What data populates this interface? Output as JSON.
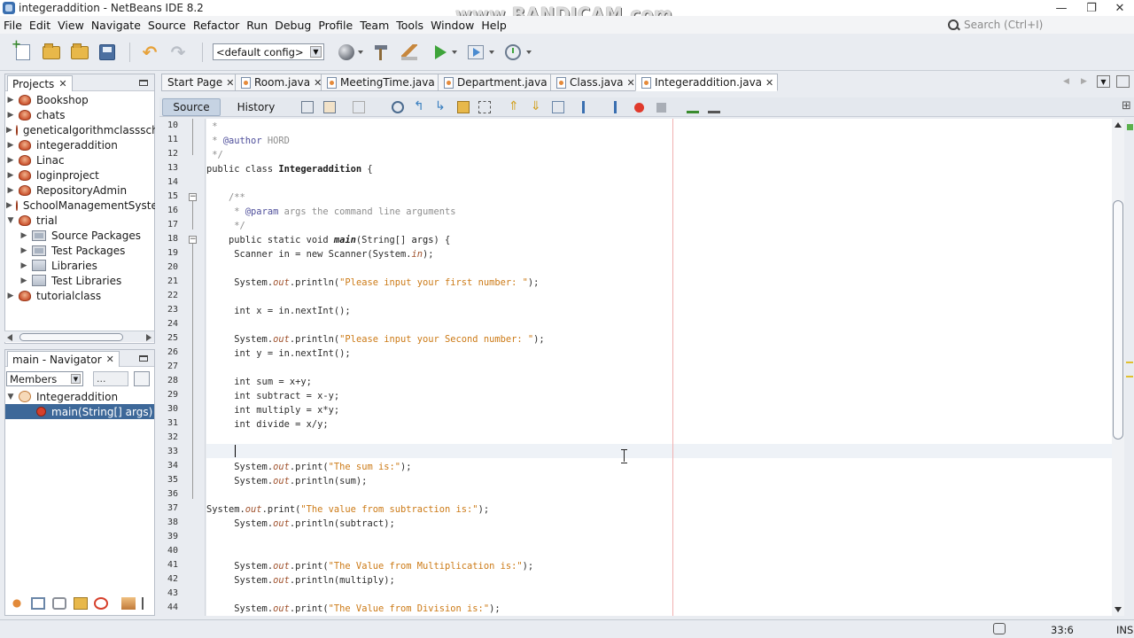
{
  "window": {
    "title": "integeraddition - NetBeans IDE 8.2",
    "watermark": "www.BANDICAM.com",
    "minimize": "—",
    "restore": "❐",
    "close": "✕"
  },
  "menu": [
    "File",
    "Edit",
    "View",
    "Navigate",
    "Source",
    "Refactor",
    "Run",
    "Debug",
    "Profile",
    "Team",
    "Tools",
    "Window",
    "Help"
  ],
  "search": {
    "placeholder": "Search (Ctrl+I)"
  },
  "toolbar": {
    "config": "<default config>"
  },
  "projects_panel": {
    "tab": "Projects",
    "items": [
      {
        "label": "Bookshop",
        "icon": "project-icon",
        "expanded": false
      },
      {
        "label": "chats",
        "icon": "project-icon",
        "expanded": false
      },
      {
        "label": "geneticalgorithmclasssch",
        "icon": "project-icon",
        "expanded": false
      },
      {
        "label": "integeraddition",
        "icon": "project-icon",
        "expanded": false
      },
      {
        "label": "Linac",
        "icon": "project-icon",
        "expanded": false
      },
      {
        "label": "loginproject",
        "icon": "project-icon",
        "expanded": false
      },
      {
        "label": "RepositoryAdmin",
        "icon": "project-icon",
        "expanded": false
      },
      {
        "label": "SchoolManagementSyste",
        "icon": "project-icon",
        "expanded": false
      },
      {
        "label": "trial",
        "icon": "project-icon",
        "expanded": true
      },
      {
        "label": "Source Packages",
        "icon": "package-icon",
        "expanded": false
      },
      {
        "label": "Test Packages",
        "icon": "package-icon",
        "expanded": false
      },
      {
        "label": "Libraries",
        "icon": "library-icon",
        "expanded": false
      },
      {
        "label": "Test Libraries",
        "icon": "library-icon",
        "expanded": false
      },
      {
        "label": "tutorialclass",
        "icon": "project-icon",
        "expanded": false
      }
    ]
  },
  "navigator_panel": {
    "tab": "main - Navigator",
    "filter": "Members",
    "dots": "...",
    "class_name": "Integeraddition",
    "method": "main(String[] args)"
  },
  "editor_tabs": [
    {
      "label": "Start Page",
      "active": false
    },
    {
      "label": "Room.java",
      "active": false
    },
    {
      "label": "MeetingTime.java",
      "active": false
    },
    {
      "label": "Department.java",
      "active": false
    },
    {
      "label": "Class.java",
      "active": false
    },
    {
      "label": "Integeraddition.java",
      "active": true
    }
  ],
  "editor_subtabs": {
    "source": "Source",
    "history": "History"
  },
  "code": {
    "line_numbers": [
      "10",
      "11",
      "12",
      "13",
      "14",
      "15",
      "16",
      "17",
      "18",
      "19",
      "20",
      "21",
      "22",
      "23",
      "24",
      "25",
      "26",
      "27",
      "28",
      "29",
      "30",
      "31",
      "32",
      "33",
      "34",
      "35",
      "36",
      "37",
      "38",
      "39",
      "40",
      "41",
      "42",
      "43",
      "44"
    ],
    "lines": [
      " *",
      " * @author HORD",
      " */",
      "public class Integeraddition {",
      "",
      "    /**",
      "     * @param args the command line arguments",
      "     */",
      "    public static void main(String[] args) {",
      "     Scanner in = new Scanner(System.in);",
      "",
      "     System.out.println(\"Please input your first number: \");",
      "",
      "     int x = in.nextInt();",
      "",
      "     System.out.println(\"Please input your Second number: \");",
      "     int y = in.nextInt();",
      "",
      "     int sum = x+y;",
      "     int subtract = x-y;",
      "     int multiply = x*y;",
      "     int divide = x/y;",
      "",
      "",
      "     System.out.print(\"The sum is:\");",
      "     System.out.println(sum);",
      "",
      "System.out.print(\"The value from subtraction is:\");",
      "     System.out.println(subtract);",
      "",
      "",
      "     System.out.print(\"The Value from Multiplication is:\");",
      "     System.out.println(multiply);",
      "",
      "     System.out.print(\"The Value from Division is:\");"
    ]
  },
  "status": {
    "position": "33:6",
    "mode": "INS"
  }
}
